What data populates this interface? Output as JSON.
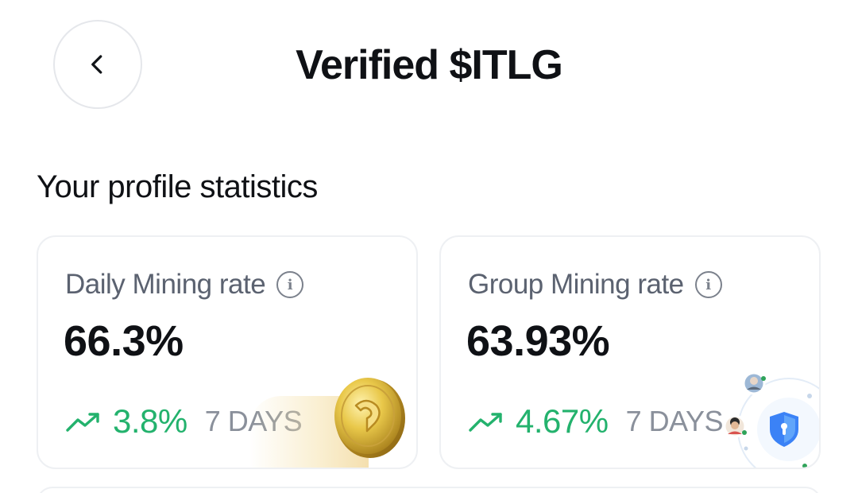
{
  "header": {
    "title": "Verified $ITLG",
    "back_icon": "chevron-left-icon"
  },
  "section": {
    "title": "Your profile statistics"
  },
  "cards": [
    {
      "label": "Daily Mining rate",
      "value": "66.3%",
      "trend_value": "3.8%",
      "trend_period": "7 DAYS",
      "trend_icon": "trending-up-icon",
      "decoration": "coin-icon"
    },
    {
      "label": "Group Mining rate",
      "value": "63.93%",
      "trend_value": "4.67%",
      "trend_period": "7 DAYS",
      "trend_icon": "trending-up-icon",
      "decoration": "group-shield-icon"
    }
  ],
  "colors": {
    "trend_positive": "#23b26d",
    "label_gray": "#5b6270",
    "period_gray": "#8a909b",
    "card_border": "#eef0f3"
  }
}
